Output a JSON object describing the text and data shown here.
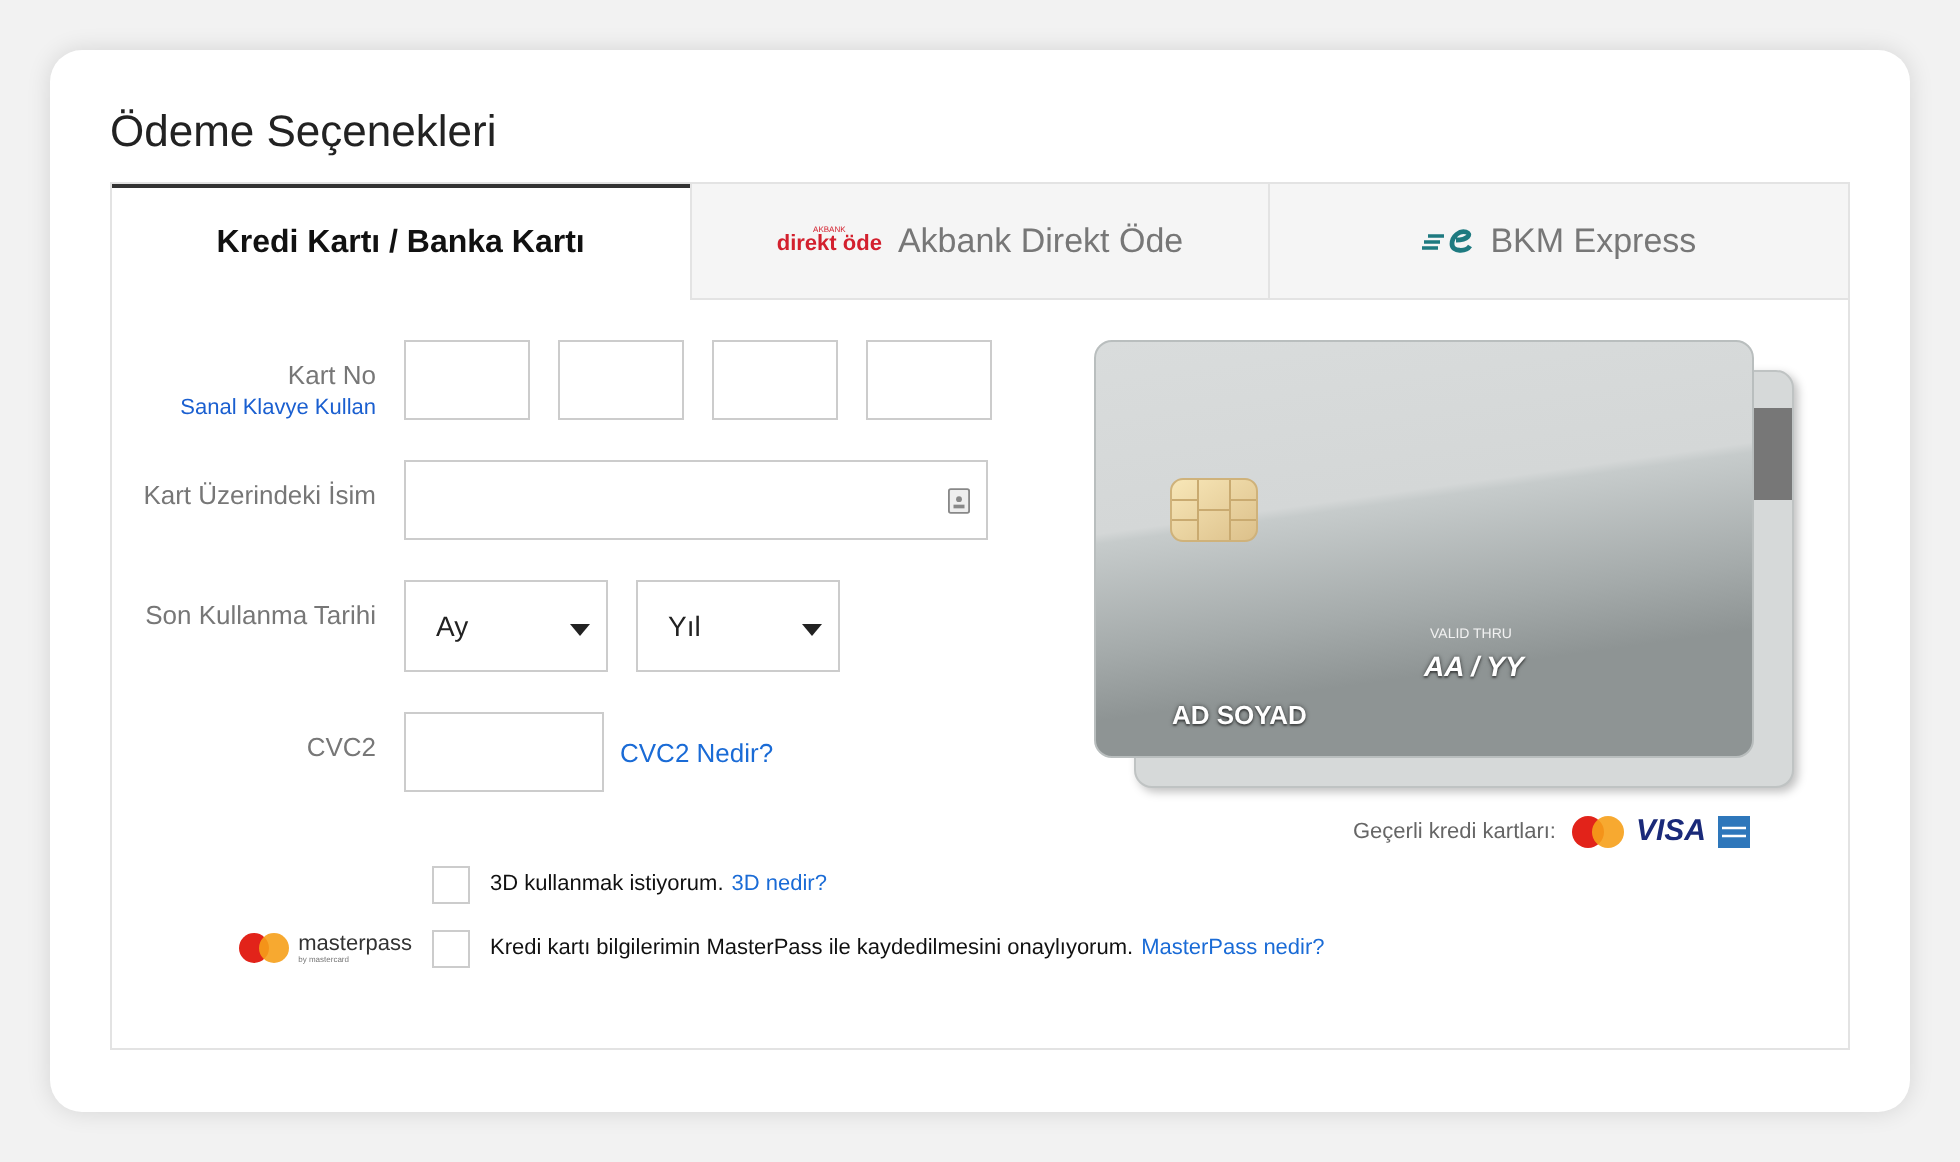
{
  "title": "Ödeme Seçenekleri",
  "tabs": [
    {
      "kind": "card",
      "label": "Kredi Kartı / Banka Kartı",
      "selected": true
    },
    {
      "kind": "akbank",
      "logo_small": "AKBANK",
      "logo": "direkt öde",
      "label": "Akbank Direkt Öde",
      "selected": false
    },
    {
      "kind": "bkm",
      "label": "BKM Express",
      "selected": false
    }
  ],
  "form": {
    "card_no_label": "Kart No",
    "virtual_keyboard_link": "Sanal Klavye Kullan",
    "name_label": "Kart Üzerindeki İsim",
    "expiry_label": "Son Kullanma Tarihi",
    "month": "Ay",
    "year": "Yıl",
    "cvc_label": "CVC2",
    "cvc_link": "CVC2 Nedir?"
  },
  "options": [
    {
      "kind": "plain",
      "label": "3D kullanmak istiyorum.",
      "link": "3D nedir?",
      "checked": false
    },
    {
      "kind": "masterpass",
      "logo": "masterpass",
      "logo_sub": "by mastercard",
      "label": "Kredi kartı bilgilerimin MasterPass ile kaydedilmesini onaylıyorum.",
      "link": "MasterPass nedir?",
      "checked": false
    }
  ],
  "card_preview": {
    "valid_thru": "VALID THRU",
    "expiry": "AA / YY",
    "holder": "AD SOYAD",
    "accepted_label": "Geçerli kredi kartları:",
    "visa": "VISA"
  }
}
